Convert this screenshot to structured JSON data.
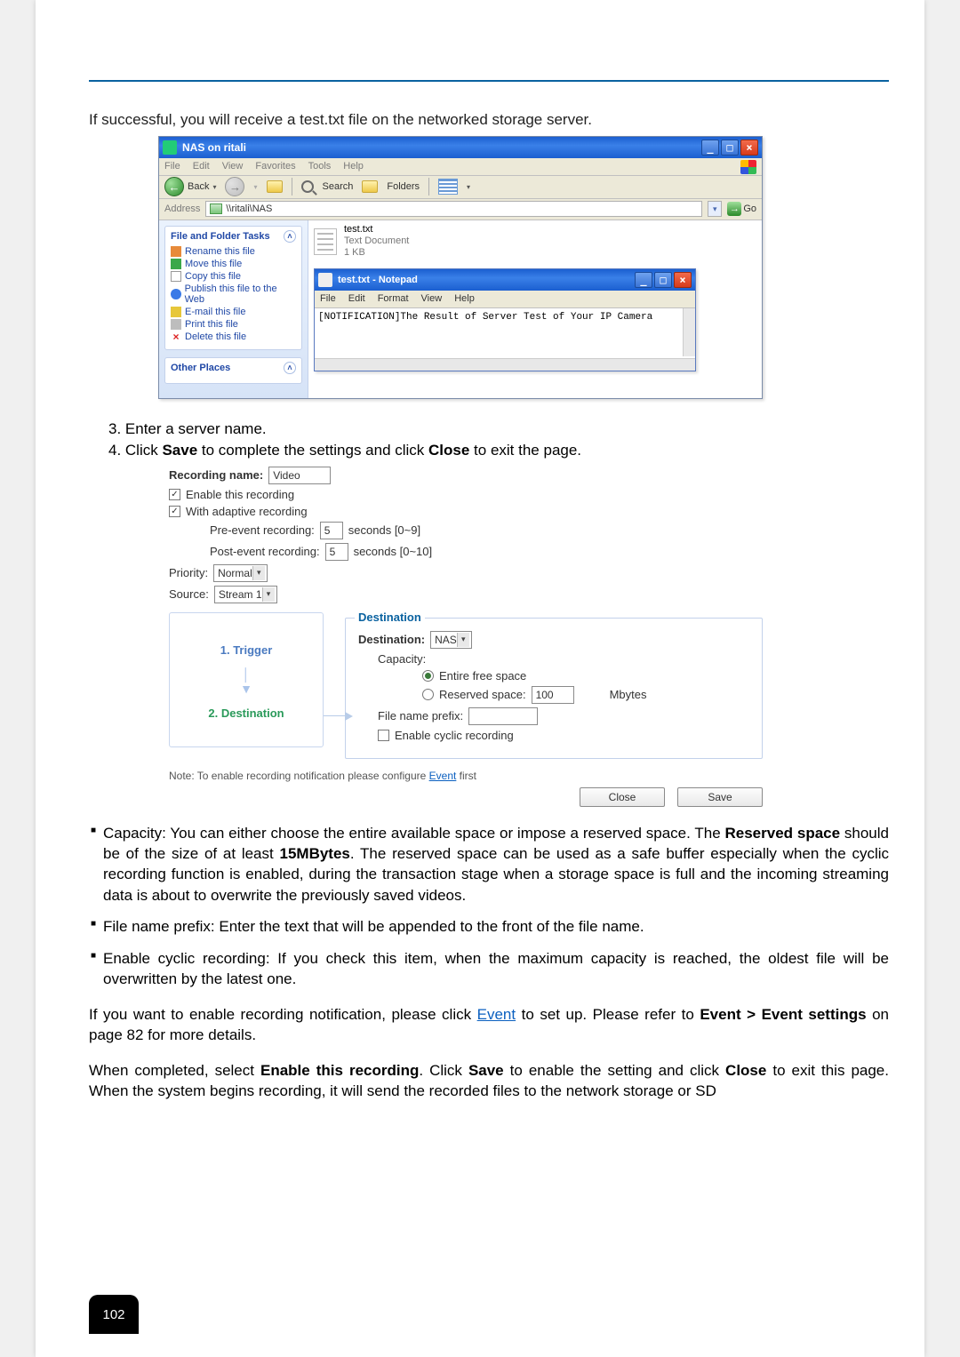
{
  "intro": "If successful, you will receive a test.txt file on the networked storage server.",
  "explorer": {
    "title": "NAS on ritali",
    "menus": [
      "File",
      "Edit",
      "View",
      "Favorites",
      "Tools",
      "Help"
    ],
    "toolbar": {
      "back": "Back",
      "search": "Search",
      "folders": "Folders"
    },
    "address_label": "Address",
    "address_value": "\\\\ritali\\NAS",
    "go": "Go",
    "tasks_header": "File and Folder Tasks",
    "tasks": {
      "rename": "Rename this file",
      "move": "Move this file",
      "copy": "Copy this file",
      "publish": "Publish this file to the Web",
      "email": "E-mail this file",
      "print": "Print this file",
      "delete": "Delete this file"
    },
    "other_places": "Other Places",
    "file": {
      "name": "test.txt",
      "type": "Text Document",
      "size": "1 KB"
    },
    "notepad": {
      "title": "test.txt - Notepad",
      "menus": [
        "File",
        "Edit",
        "Format",
        "View",
        "Help"
      ],
      "body": "[NOTIFICATION]The Result of Server Test of Your IP Camera"
    }
  },
  "steps": {
    "s3": "3. Enter a server name.",
    "s4_pre": "4. Click ",
    "s4_save": "Save",
    "s4_mid": " to complete the settings and click ",
    "s4_close": "Close",
    "s4_post": " to exit the page."
  },
  "dialog": {
    "rec_name_label": "Recording name:",
    "rec_name_value": "Video",
    "enable": "Enable this recording",
    "adaptive": "With adaptive recording",
    "pre_label": "Pre-event recording:",
    "pre_val": "5",
    "pre_unit": "seconds [0~9]",
    "post_label": "Post-event recording:",
    "post_val": "5",
    "post_unit": "seconds [0~10]",
    "priority_label": "Priority:",
    "priority_val": "Normal",
    "source_label": "Source:",
    "source_val": "Stream 1",
    "flow_trigger": "1.  Trigger",
    "flow_destination": "2.  Destination",
    "dest_legend": "Destination",
    "dest_label": "Destination:",
    "dest_val": "NAS",
    "capacity": "Capacity:",
    "entire": "Entire free space",
    "reserved": "Reserved space:",
    "reserved_val": "100",
    "reserved_unit": "Mbytes",
    "prefix": "File name prefix:",
    "prefix_val": "",
    "cyclic": "Enable cyclic recording",
    "note_before": "Note: To enable recording notification please configure ",
    "note_link": "Event",
    "note_after": " first",
    "btn_close": "Close",
    "btn_save": "Save"
  },
  "bullets": {
    "b1_pre": "Capacity: You can either choose the entire available space or impose a reserved space. The ",
    "b1_bold1": "Reserved space",
    "b1_mid": " should be of the size of at least ",
    "b1_bold2": "15MBytes",
    "b1_post": ". The reserved space can be used as a safe buffer especially when the cyclic recording function is enabled, during the transaction stage when a storage space is full and the incoming streaming data is about to overwrite the previously saved videos.",
    "b2": "File name prefix: Enter the text that will be appended to the front of the file name.",
    "b3": "Enable cyclic recording: If you check this item, when the maximum capacity is reached, the oldest file will be overwritten by the latest one."
  },
  "para1_pre": "If you want to enable recording notification, please click ",
  "para1_link": "Event",
  "para1_mid": " to set up. Please refer to ",
  "para1_bold": "Event > Event settings",
  "para1_post": " on page 82 for more details.",
  "para2_pre": "When completed, select ",
  "para2_b1": "Enable this recording",
  "para2_m1": ". Click ",
  "para2_b2": "Save",
  "para2_m2": " to enable the setting and click ",
  "para2_b3": "Close",
  "para2_post": " to exit this page. When the system begins recording, it will send the recorded files to the network storage or SD",
  "page_number": "102"
}
